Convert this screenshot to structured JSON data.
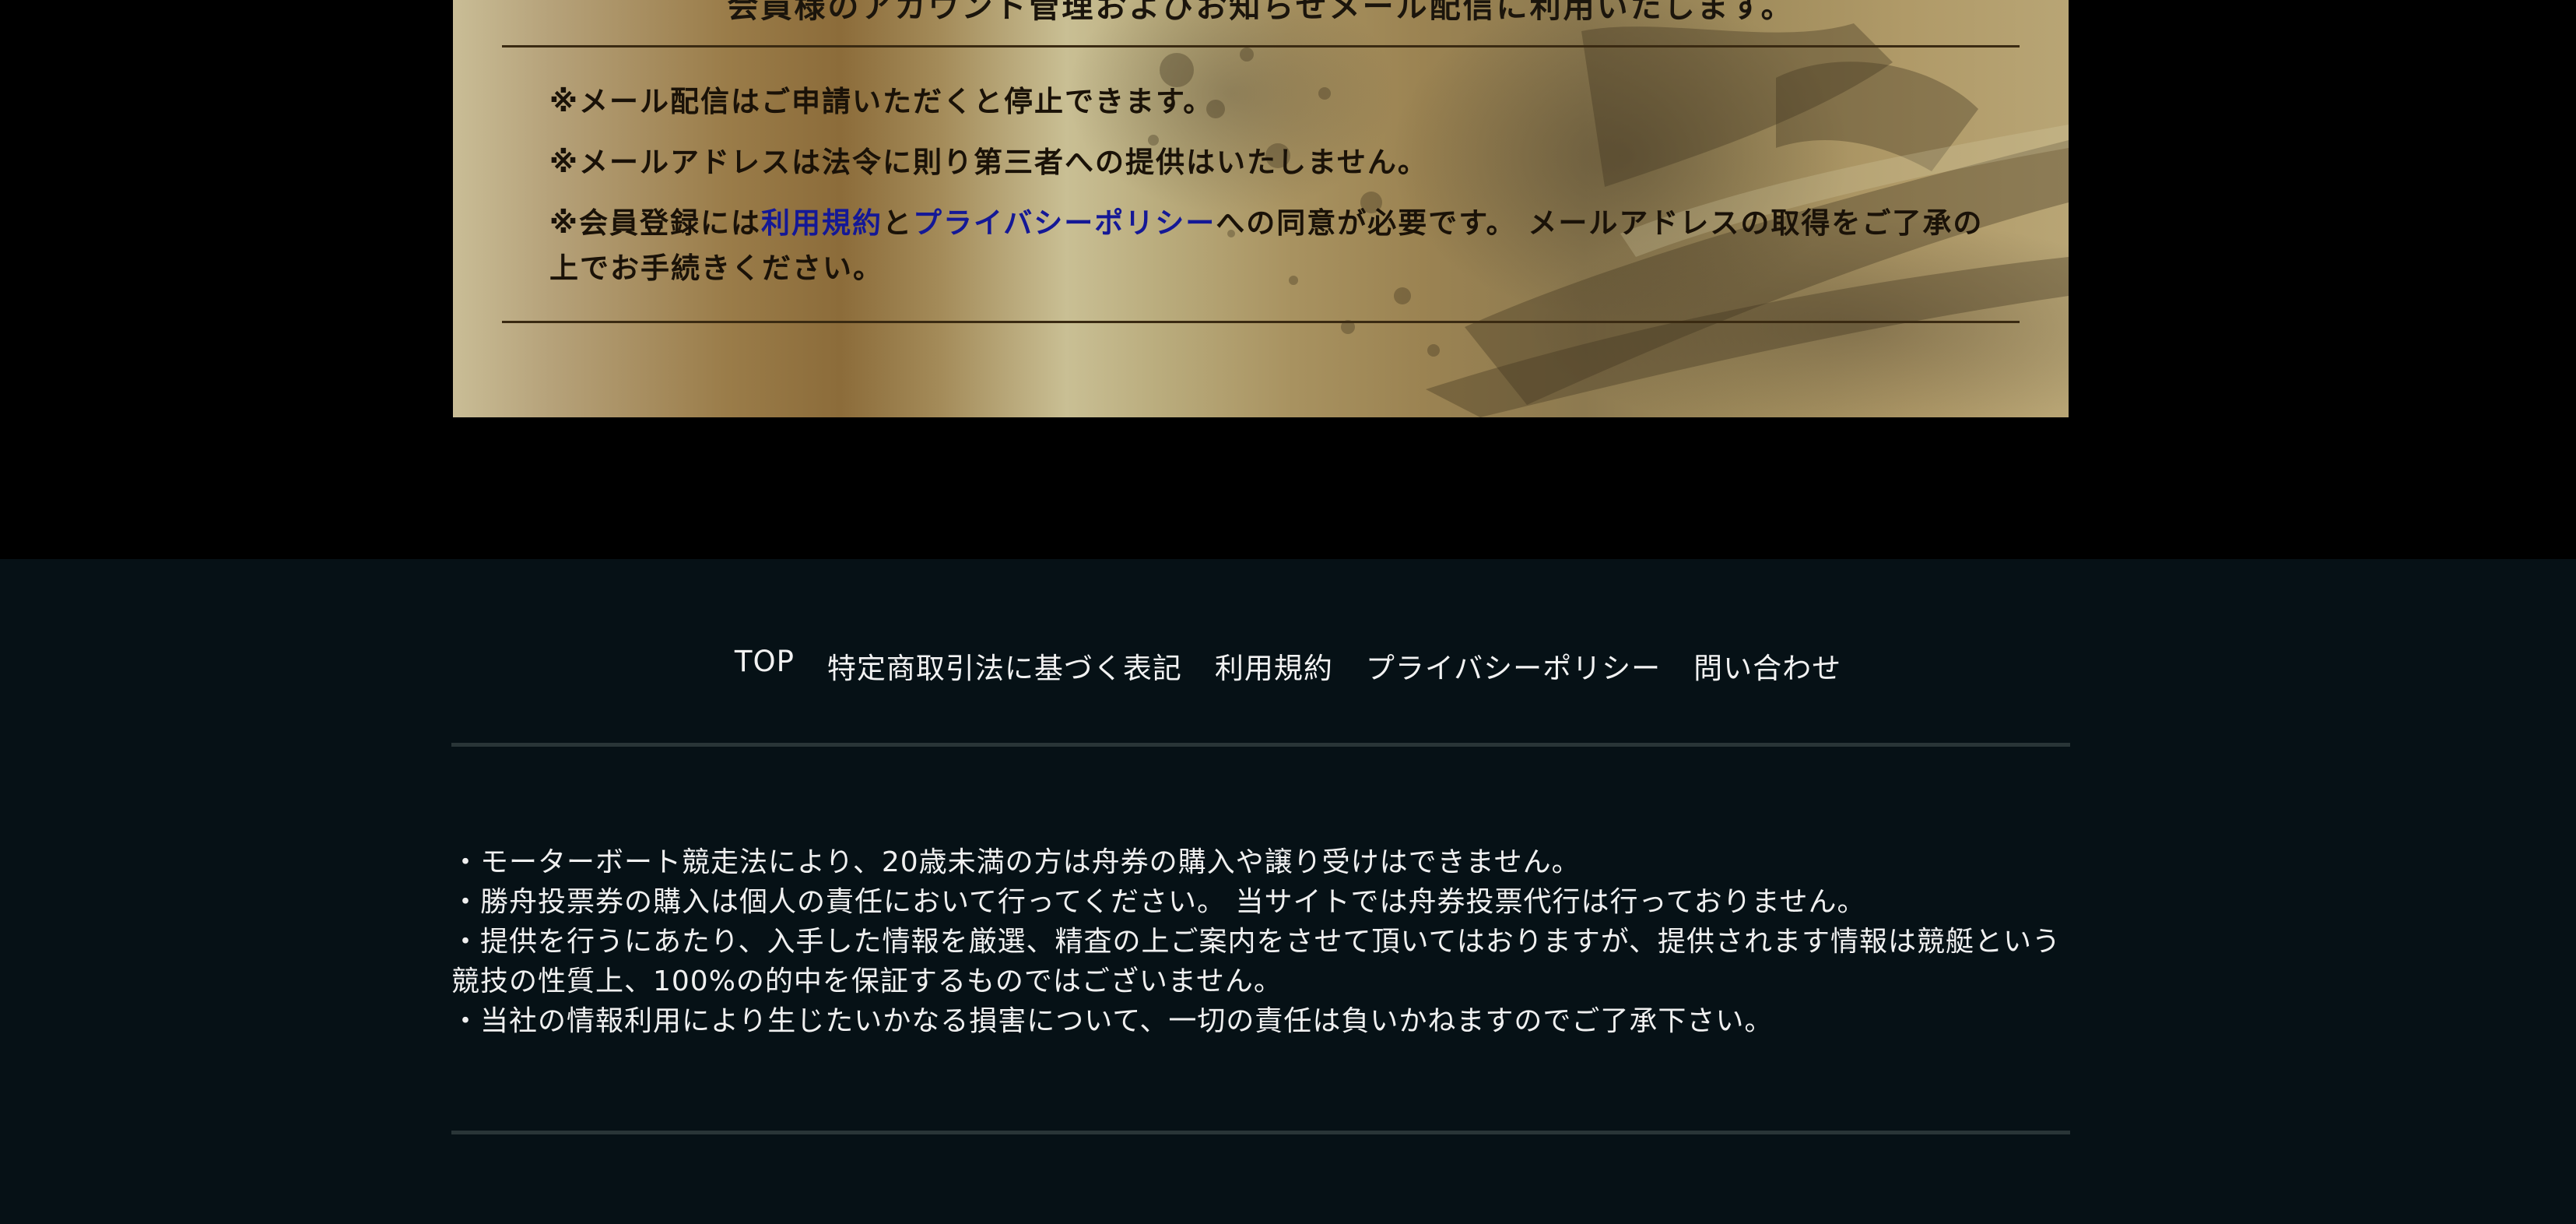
{
  "banner": {
    "heading_partial": "会員様のアカウント管理およびお知らせメール配信に利用いたします。",
    "notes": [
      "※メール配信はご申請いただくと停止できます。",
      "※メールアドレスは法令に則り第三者への提供はいたしません。"
    ],
    "consent": {
      "prefix": "※会員登録には",
      "terms_link": "利用規約",
      "connector": "と",
      "privacy_link": "プライバシーポリシー",
      "suffix": "への同意が必要です。 メールアドレスの取得をご了承の上でお手続きください。"
    },
    "colors": {
      "link": "#141896",
      "rule": "#3a2a12"
    }
  },
  "footer": {
    "nav": [
      "TOP",
      "特定商取引法に基づく表記",
      "利用規約",
      "プライバシーポリシー",
      "問い合わせ"
    ],
    "disclaimer": [
      "・モーターボート競走法により、20歳未満の方は舟券の購入や譲り受けはできません。",
      "・勝舟投票券の購入は個人の責任において行ってください。 当サイトでは舟券投票代行は行っておりません。",
      "・提供を行うにあたり、入手した情報を厳選、精査の上ご案内をさせて頂いてはおりますが、提供されます情報は競艇という競技の性質上、100%の的中を保証するものではございません。",
      "・当社の情報利用により生じたいかなる損害について、一切の責任は負いかねますのでご了承下さい。"
    ],
    "colors": {
      "background": "#061116",
      "rule": "#293537",
      "text": "#f0f0f0"
    }
  }
}
